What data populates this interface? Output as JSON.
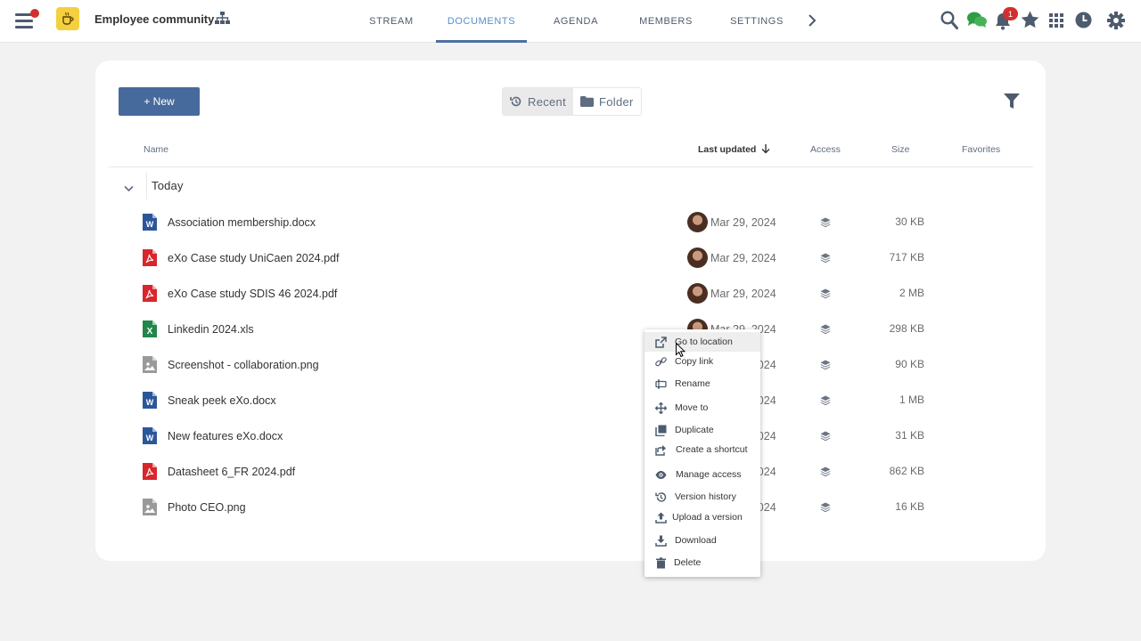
{
  "topbar": {
    "space_name": "Employee community",
    "notification_count": "1",
    "tabs": [
      {
        "label": "STREAM"
      },
      {
        "label": "DOCUMENTS"
      },
      {
        "label": "AGENDA"
      },
      {
        "label": "MEMBERS"
      },
      {
        "label": "SETTINGS"
      }
    ],
    "active_tab": "DOCUMENTS",
    "accent_color": "#4d6fa3",
    "icons": [
      "menu-icon",
      "hierarchy-icon",
      "chevron-right-icon",
      "search-icon",
      "chat-icon",
      "bell-icon",
      "star-icon",
      "apps-grid-icon",
      "clock-icon",
      "gear-icon"
    ]
  },
  "toolbar": {
    "new_label": "+ New",
    "recent_label": "Recent",
    "folder_label": "Folder",
    "button_color": "#476a9c"
  },
  "table": {
    "headers": {
      "name": "Name",
      "last_updated": "Last updated",
      "access": "Access",
      "size": "Size",
      "favorites": "Favorites"
    },
    "group_label": "Today",
    "rows": [
      {
        "name": "Association membership.docx",
        "type": "word",
        "date": "Mar 29, 2024",
        "size": "30 KB"
      },
      {
        "name": "eXo Case study UniCaen 2024.pdf",
        "type": "pdf",
        "date": "Mar 29, 2024",
        "size": "717 KB"
      },
      {
        "name": "eXo Case study SDIS 46 2024.pdf",
        "type": "pdf",
        "date": "Mar 29, 2024",
        "size": "2 MB"
      },
      {
        "name": "Linkedin 2024.xls",
        "type": "excel",
        "date": "Mar 29, 2024",
        "size": "298 KB"
      },
      {
        "name": "Screenshot - collaboration.png",
        "type": "image",
        "date": "Mar 29, 2024",
        "size": "90 KB"
      },
      {
        "name": "Sneak peek eXo.docx",
        "type": "word",
        "date": "Mar 29, 2024",
        "size": "1 MB"
      },
      {
        "name": "New features eXo.docx",
        "type": "word",
        "date": "Mar 29, 2024",
        "size": "31 KB"
      },
      {
        "name": "Datasheet 6_FR 2024.pdf",
        "type": "pdf",
        "date": "Mar 29, 2024",
        "size": "862 KB"
      },
      {
        "name": "Photo CEO.png",
        "type": "image",
        "date": "Mar 29, 2024",
        "size": "16 KB"
      }
    ]
  },
  "context_menu": {
    "items": [
      {
        "label": "Go to location",
        "icon": "external-link-icon"
      },
      {
        "label": "Copy link",
        "icon": "link-icon"
      },
      {
        "label": "Rename",
        "icon": "rename-icon"
      },
      {
        "label": "Move to",
        "icon": "move-icon"
      },
      {
        "label": "Duplicate",
        "icon": "copy-icon"
      },
      {
        "label": "Create a shortcut",
        "icon": "shortcut-icon"
      },
      {
        "label": "Manage access",
        "icon": "eye-icon"
      },
      {
        "label": "Version history",
        "icon": "history-icon"
      },
      {
        "label": "Upload a version",
        "icon": "upload-icon"
      },
      {
        "label": "Download",
        "icon": "download-icon"
      },
      {
        "label": "Delete",
        "icon": "trash-icon"
      }
    ]
  }
}
